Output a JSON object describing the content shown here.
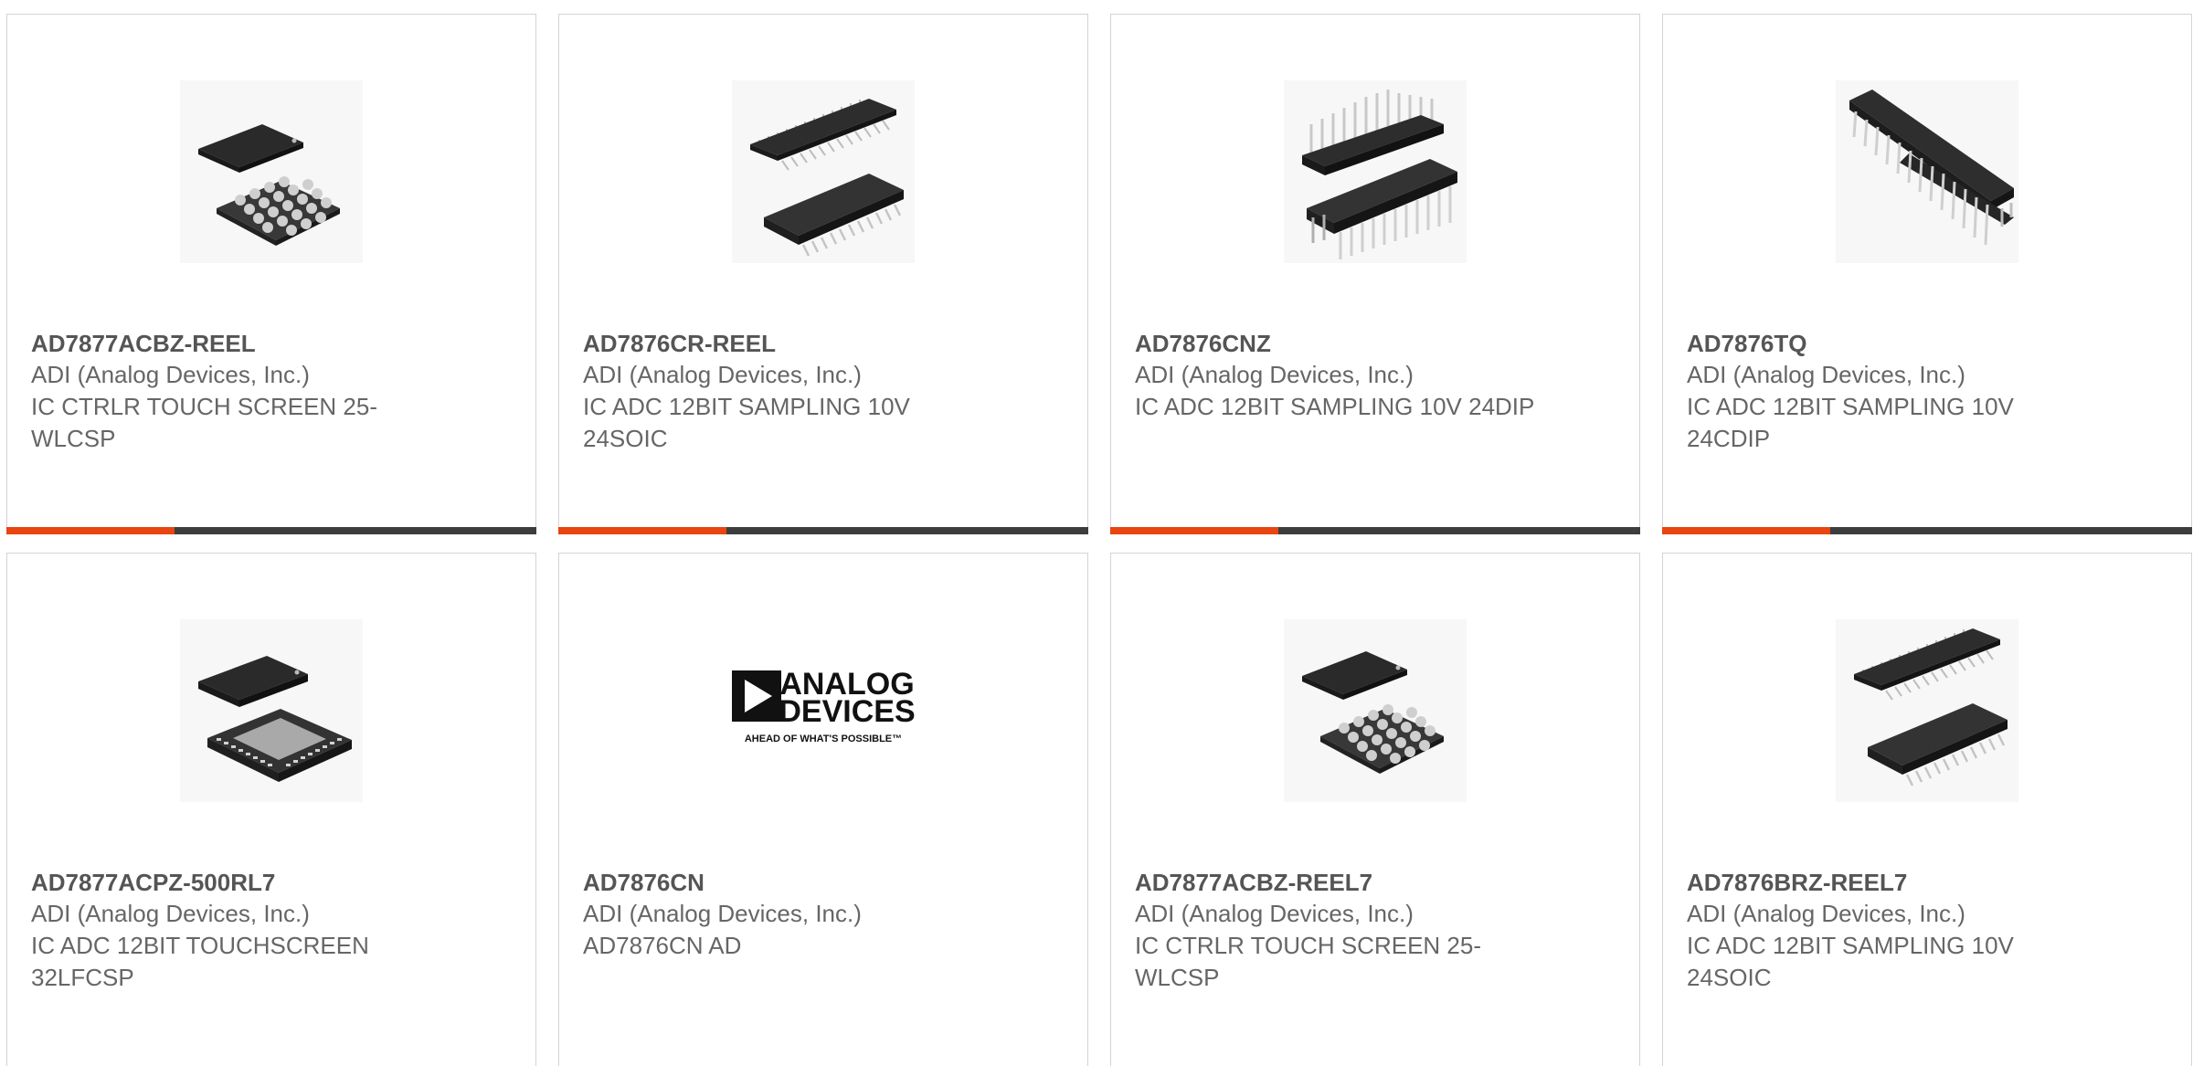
{
  "colors": {
    "accent": "#e84511",
    "bar_dark": "#3d3d3d",
    "border": "#d4d4d4"
  },
  "products": [
    {
      "part_number": "AD7877ACBZ-REEL",
      "manufacturer": "ADI (Analog Devices, Inc.)",
      "description": "IC CTRLR TOUCH SCREEN 25-WLCSP",
      "image": "wlcsp-chip-icon"
    },
    {
      "part_number": "AD7876CR-REEL",
      "manufacturer": "ADI (Analog Devices, Inc.)",
      "description": "IC ADC 12BIT SAMPLING 10V 24SOIC",
      "image": "soic-chip-icon"
    },
    {
      "part_number": "AD7876CNZ",
      "manufacturer": "ADI (Analog Devices, Inc.)",
      "description": "IC ADC 12BIT SAMPLING 10V 24DIP",
      "image": "dip-chip-icon"
    },
    {
      "part_number": "AD7876TQ",
      "manufacturer": "ADI (Analog Devices, Inc.)",
      "description": "IC ADC 12BIT SAMPLING 10V 24CDIP",
      "image": "cdip-chip-icon"
    },
    {
      "part_number": "AD7877ACPZ-500RL7",
      "manufacturer": "ADI (Analog Devices, Inc.)",
      "description": "IC ADC 12BIT TOUCHSCREEN 32LFCSP",
      "image": "lfcsp-chip-icon"
    },
    {
      "part_number": "AD7876CN",
      "manufacturer": "ADI (Analog Devices, Inc.)",
      "description": "AD7876CN AD",
      "image": "analog-devices-logo",
      "logo_text": [
        "ANALOG",
        "DEVICES",
        "AHEAD OF WHAT'S POSSIBLE™"
      ]
    },
    {
      "part_number": "AD7877ACBZ-REEL7",
      "manufacturer": "ADI (Analog Devices, Inc.)",
      "description": "IC CTRLR TOUCH SCREEN 25-WLCSP",
      "image": "wlcsp-chip-icon"
    },
    {
      "part_number": "AD7876BRZ-REEL7",
      "manufacturer": "ADI (Analog Devices, Inc.)",
      "description": "IC ADC 12BIT SAMPLING 10V 24SOIC",
      "image": "soic-chip-icon"
    }
  ]
}
